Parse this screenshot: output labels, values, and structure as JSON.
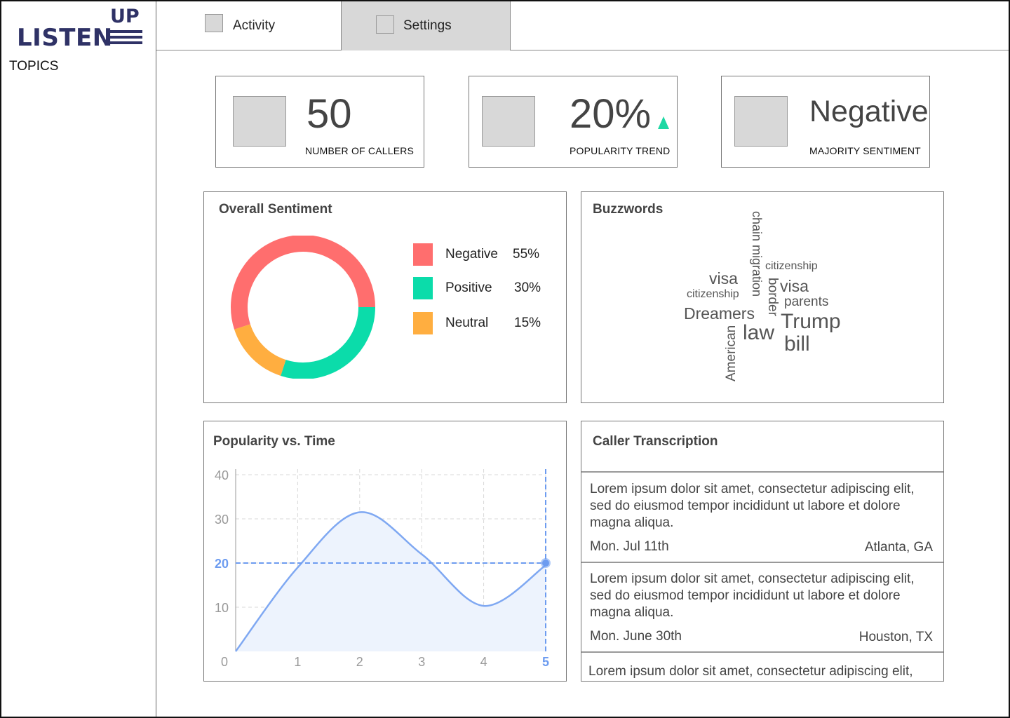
{
  "brand": {
    "word": "LISTEN",
    "accent": "UP"
  },
  "sidebar": {
    "heading": "TOPICS"
  },
  "tabs": [
    {
      "label": "Activity",
      "active": true
    },
    {
      "label": "Settings",
      "active": false
    }
  ],
  "stats": {
    "callers": {
      "value": "50",
      "caption": "NUMBER OF CALLERS"
    },
    "trend": {
      "value": "20%",
      "caption": "POPULARITY TREND",
      "direction": "up",
      "color": "#1ed8a4"
    },
    "sentiment": {
      "value": "Negative",
      "caption": "MAJORITY SENTIMENT"
    }
  },
  "sentiment_card": {
    "title": "Overall Sentiment",
    "legend": [
      {
        "label": "Negative",
        "percent": "55%",
        "color": "#ff6e6e"
      },
      {
        "label": "Positive",
        "percent": "30%",
        "color": "#0bdcaa"
      },
      {
        "label": "Neutral",
        "percent": "15%",
        "color": "#ffae40"
      }
    ]
  },
  "buzzwords_card": {
    "title": "Buzzwords",
    "words": [
      "chain migration",
      "citizenship",
      "visa",
      "citizenship",
      "border",
      "visa",
      "parents",
      "Dreamers",
      "Trump",
      "law",
      "bill",
      "American"
    ]
  },
  "popularity_card": {
    "title": "Popularity vs. Time"
  },
  "chart_data": {
    "type": "area",
    "title": "Popularity vs. Time",
    "xlabel": "",
    "ylabel": "",
    "x": [
      0,
      1,
      2,
      3,
      4,
      5
    ],
    "x_ticks": [
      "0",
      "1",
      "2",
      "3",
      "4",
      "5"
    ],
    "y_ticks": [
      "10",
      "20",
      "30",
      "40"
    ],
    "series": [
      {
        "values": [
          0,
          19,
          31.5,
          22,
          10.3,
          19.5
        ]
      }
    ],
    "xlim": [
      0,
      5
    ],
    "ylim": [
      0,
      40
    ],
    "highlight": {
      "x": 5,
      "y": 20
    },
    "grid": true,
    "line_color": "#7fa8f2",
    "fill_color": "#edf3fd"
  },
  "transcription_card": {
    "title": "Caller Transcription",
    "entries": [
      {
        "text": "Lorem ipsum dolor sit amet, consectetur adipiscing elit, sed do eiusmod tempor incididunt ut labore et dolore magna aliqua.",
        "date": "Mon. Jul 11th",
        "location": "Atlanta, GA"
      },
      {
        "text": "Lorem ipsum dolor sit amet, consectetur adipiscing elit, sed do eiusmod tempor incididunt ut labore et dolore magna aliqua.",
        "date": "Mon. June 30th",
        "location": "Houston, TX"
      },
      {
        "text": "Lorem ipsum dolor sit amet, consectetur adipiscing elit,"
      }
    ]
  }
}
